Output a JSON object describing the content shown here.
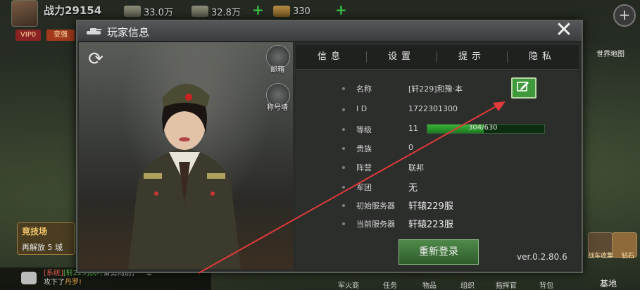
{
  "hud": {
    "power": "战力29154",
    "res1": "33.0万",
    "res2": "32.8万",
    "res3": "330",
    "vip": "VIP0",
    "stronger": "变强",
    "world_map": "世界地图",
    "arena_title": "竞技场",
    "arena_sub": "再解放 5 城",
    "chat": {
      "prefix": "[系统]",
      "name": "[轩229]枫叶",
      "text": "奋勇向前，一举",
      "text2": "攻下了",
      "place": "丹罗!"
    },
    "bottom_tabs": [
      "军火商",
      "任务",
      "物品",
      "组织",
      "指挥官",
      "背包"
    ],
    "base": "基地",
    "side_icon_1": "战车收集",
    "side_icon_2": "钻石"
  },
  "dialog": {
    "title": "玩家信息",
    "close": "✕",
    "side_buttons": [
      "邮箱",
      "称号墙"
    ],
    "tabs": [
      "信息",
      "设置",
      "提示",
      "隐私"
    ],
    "rows": [
      {
        "label": "名称",
        "value": "[轩229]和豫·本"
      },
      {
        "label": "I D",
        "value": "1722301300"
      },
      {
        "label": "等级",
        "value": "11"
      },
      {
        "label": "贵族",
        "value": "0"
      },
      {
        "label": "阵营",
        "value": "联邦"
      },
      {
        "label": "军团",
        "value": "无"
      },
      {
        "label": "初始服务器",
        "value": "轩辕229服"
      },
      {
        "label": "当前服务器",
        "value": "轩辕223服"
      }
    ],
    "exp_text": "304/630",
    "exp_fraction": 0.483,
    "relogin": "重新登录",
    "version": "ver.0.2.80.6"
  }
}
